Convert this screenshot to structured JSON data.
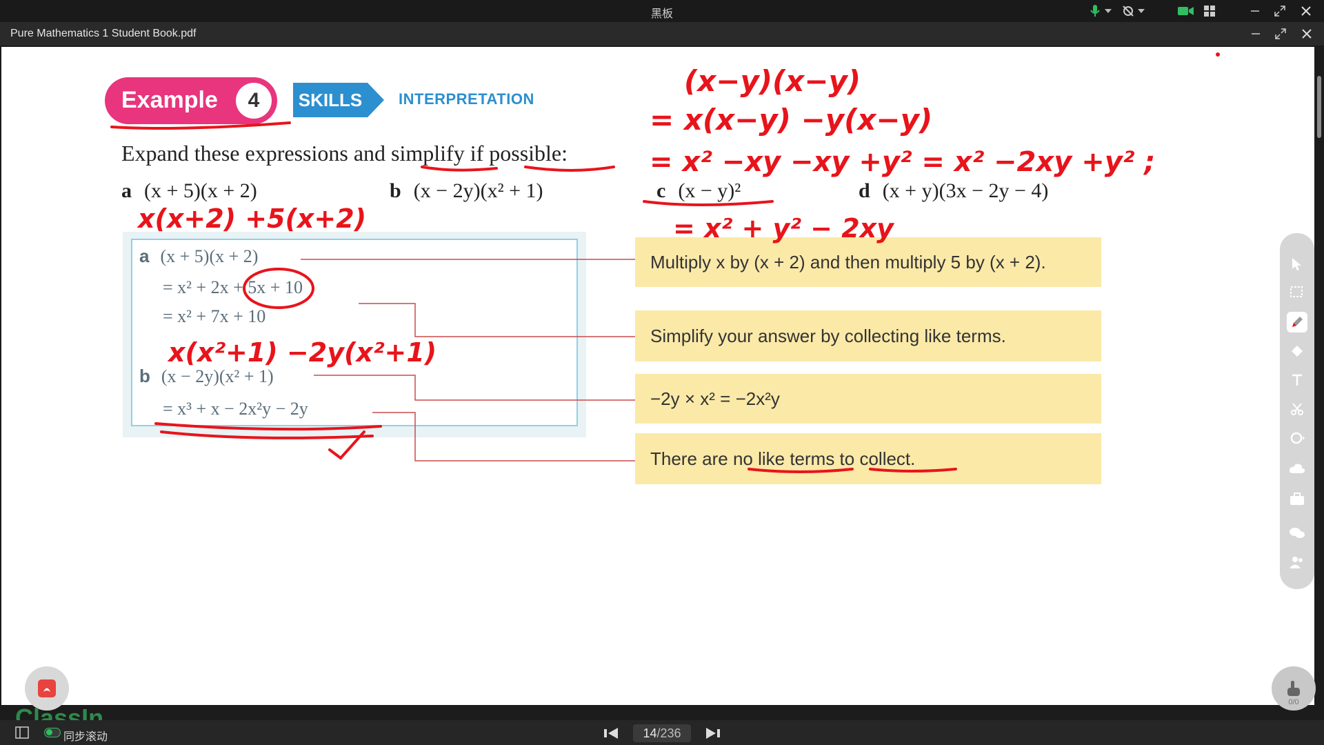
{
  "window": {
    "title": "黑板"
  },
  "document": {
    "title": "Pure Mathematics 1 Student Book.pdf"
  },
  "example": {
    "label": "Example",
    "number": "4",
    "skills": "SKILLS",
    "interpretation": "INTERPRETATION",
    "instruction": "Expand these expressions and simplify if possible:",
    "questions": [
      {
        "letter": "a",
        "expr": "(x + 5)(x + 2)"
      },
      {
        "letter": "b",
        "expr": "(x − 2y)(x² + 1)"
      },
      {
        "letter": "c",
        "expr": "(x − y)²"
      },
      {
        "letter": "d",
        "expr": "(x + y)(3x − 2y − 4)"
      }
    ]
  },
  "solution": {
    "a_label": "a",
    "a_line1": "(x + 5)(x + 2)",
    "a_line2": "= x² + 2x + 5x + 10",
    "a_line3": "= x² + 7x + 10",
    "b_label": "b",
    "b_line1": "(x − 2y)(x² + 1)",
    "b_line2": "= x³ + x − 2x²y − 2y"
  },
  "notes": [
    "Multiply x by (x + 2) and then multiply 5 by (x + 2).",
    "Simplify your answer by collecting like terms.",
    "−2y × x² = −2x²y",
    "There are no like terms to collect."
  ],
  "annotations": {
    "top_right_1": "(x−y)(x−y)",
    "top_right_2": "= x(x−y) −y(x−y)",
    "top_right_3": "= x² −xy −xy +y² = x² −2xy +y² ;",
    "under_c": "= x² + y² − 2xy",
    "under_a": "x(x+2) +5(x+2)",
    "near_b": "x(x²+1) −2y(x²+1)",
    "ink_color": "#e8141b"
  },
  "sidebar_tools": [
    "select-icon",
    "region-select-icon",
    "pen-icon",
    "eraser-icon",
    "text-icon",
    "scissors-icon",
    "shape-icon",
    "cloud-icon",
    "toolbox-icon",
    "chat-icon",
    "users-icon"
  ],
  "hand_raise": {
    "count": "0/0"
  },
  "brand": {
    "logo": "ClassIn"
  },
  "bottom": {
    "sync_label": "同步滚动",
    "page_current": "14",
    "page_total": "/236"
  }
}
